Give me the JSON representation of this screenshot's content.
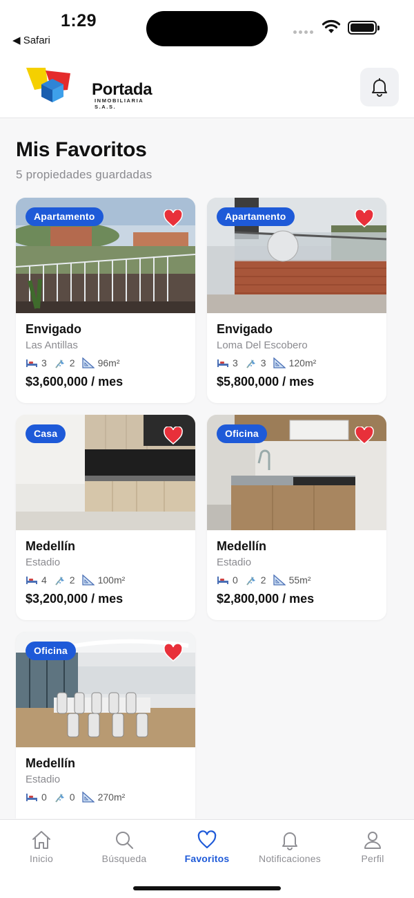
{
  "status_bar": {
    "time": "1:29",
    "back_app": "◀ Safari"
  },
  "header": {
    "logo_name": "Portada",
    "logo_sub": "INMOBILIARIA S.A.S.",
    "bell_icon": "bell-icon"
  },
  "page": {
    "title": "Mis Favoritos",
    "subtitle": "5 propiedades guardadas"
  },
  "properties": [
    {
      "type": "Apartamento",
      "city": "Envigado",
      "neighborhood": "Las Antillas",
      "beds": "3",
      "baths": "2",
      "area": "96m²",
      "price": "$3,600,000 / mes",
      "favorite": true
    },
    {
      "type": "Apartamento",
      "city": "Envigado",
      "neighborhood": "Loma Del Escobero",
      "beds": "3",
      "baths": "3",
      "area": "120m²",
      "price": "$5,800,000 / mes",
      "favorite": true
    },
    {
      "type": "Casa",
      "city": "Medellín",
      "neighborhood": "Estadio",
      "beds": "4",
      "baths": "2",
      "area": "100m²",
      "price": "$3,200,000 / mes",
      "favorite": true
    },
    {
      "type": "Oficina",
      "city": "Medellín",
      "neighborhood": "Estadio",
      "beds": "0",
      "baths": "2",
      "area": "55m²",
      "price": "$2,800,000 / mes",
      "favorite": true
    },
    {
      "type": "Oficina",
      "city": "Medellín",
      "neighborhood": "Estadio",
      "beds": "0",
      "baths": "0",
      "area": "270m²",
      "price": "",
      "favorite": true
    }
  ],
  "tabs": [
    {
      "label": "Inicio",
      "icon": "home-icon",
      "active": false
    },
    {
      "label": "Búsqueda",
      "icon": "search-icon",
      "active": false
    },
    {
      "label": "Favoritos",
      "icon": "heart-icon",
      "active": true
    },
    {
      "label": "Notificaciones",
      "icon": "bell-icon",
      "active": false
    },
    {
      "label": "Perfil",
      "icon": "user-icon",
      "active": false
    }
  ],
  "colors": {
    "accent": "#1e5ad8",
    "favorite_red": "#e8303a"
  }
}
